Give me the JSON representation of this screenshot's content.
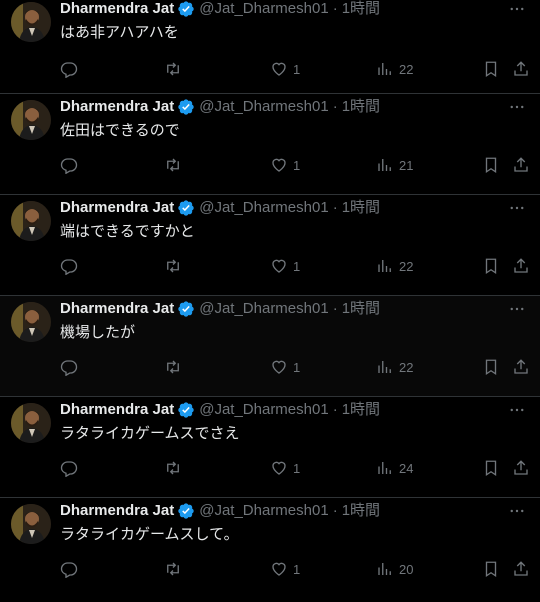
{
  "tweets": [
    {
      "name": "Dharmendra Jat",
      "handle": "@Jat_Dharmesh01",
      "dot": "·",
      "time": "1時間",
      "text": "はあ非アハアハを",
      "likes": "1",
      "views": "22"
    },
    {
      "name": "Dharmendra Jat",
      "handle": "@Jat_Dharmesh01",
      "dot": "·",
      "time": "1時間",
      "text": "佐田はできるので",
      "likes": "1",
      "views": "21"
    },
    {
      "name": "Dharmendra Jat",
      "handle": "@Jat_Dharmesh01",
      "dot": "·",
      "time": "1時間",
      "text": "端はできるですかと",
      "likes": "1",
      "views": "22"
    },
    {
      "name": "Dharmendra Jat",
      "handle": "@Jat_Dharmesh01",
      "dot": "·",
      "time": "1時間",
      "text": "機場したが",
      "likes": "1",
      "views": "22"
    },
    {
      "name": "Dharmendra Jat",
      "handle": "@Jat_Dharmesh01",
      "dot": "·",
      "time": "1時間",
      "text": "ラタライカゲームスでさえ",
      "likes": "1",
      "views": "24"
    },
    {
      "name": "Dharmendra Jat",
      "handle": "@Jat_Dharmesh01",
      "dot": "·",
      "time": "1時間",
      "text": "ラタライカゲームスして。",
      "likes": "1",
      "views": "20"
    }
  ],
  "icons": {
    "verified": "verified-badge-icon",
    "more": "more-options-icon",
    "reply": "reply-icon",
    "retweet": "retweet-icon",
    "like": "like-heart-icon",
    "views": "views-chart-icon",
    "bookmark": "bookmark-icon",
    "share": "share-icon"
  },
  "colors": {
    "background": "#000000",
    "text": "#e7e9ea",
    "muted": "#71767b",
    "verified": "#1d9bf0",
    "divider": "#2f3336"
  }
}
